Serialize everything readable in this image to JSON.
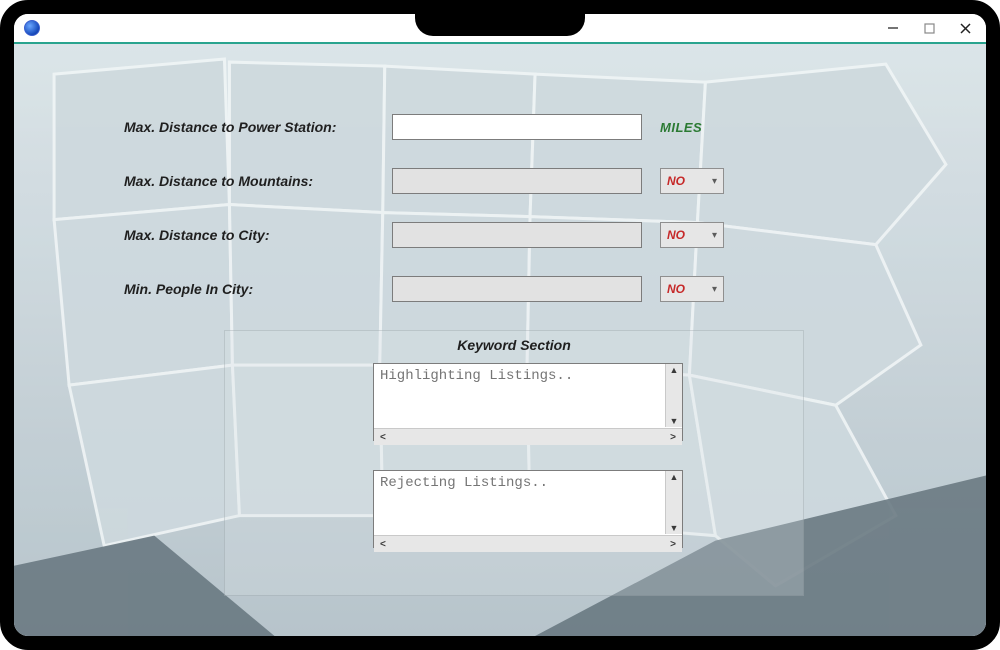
{
  "fields": {
    "power_station": {
      "label": "Max. Distance to Power Station:",
      "value": "",
      "unit": "MILES"
    },
    "mountains": {
      "label": "Max. Distance to Mountains:",
      "value": "",
      "dropdown": "NO"
    },
    "city": {
      "label": "Max. Distance to City:",
      "value": "",
      "dropdown": "NO"
    },
    "people": {
      "label": "Min. People In City:",
      "value": "",
      "dropdown": "NO"
    }
  },
  "keyword": {
    "title": "Keyword Section",
    "highlight_placeholder": "Highlighting Listings..",
    "reject_placeholder": "Rejecting Listings.."
  }
}
